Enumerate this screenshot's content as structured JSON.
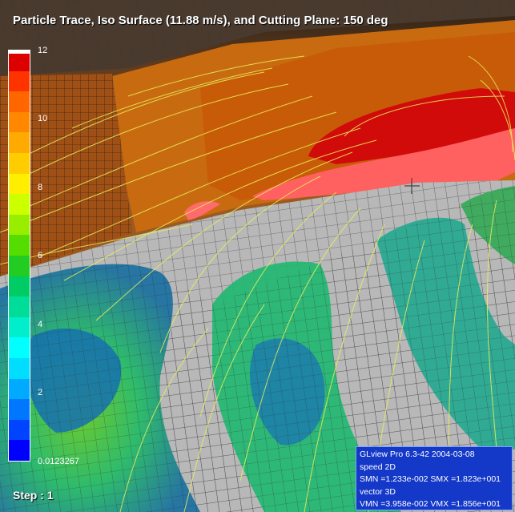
{
  "title": "Particle Trace, Iso Surface (11.88 m/s), and Cutting Plane: 150 deg",
  "step_label": "Step : 1",
  "legend": {
    "max_label": "12",
    "min_label": "0.0123267",
    "tick_labels": [
      "10",
      "8",
      "6",
      "4",
      "2"
    ],
    "colors": [
      "#dd0000",
      "#ff3300",
      "#ff6600",
      "#ff8800",
      "#ffaa00",
      "#ffcc00",
      "#ffee00",
      "#ccff00",
      "#99ee00",
      "#55dd00",
      "#22cc22",
      "#00cc66",
      "#00dd99",
      "#00eecc",
      "#00ffff",
      "#00ddff",
      "#00aaff",
      "#0077ff",
      "#0044ff",
      "#0000ff"
    ]
  },
  "info_panel": {
    "line1": "GLview Pro 6.3-42  2004-03-08",
    "line2": "speed 2D",
    "line3": "SMN =1.233e-002  SMX =1.823e+001",
    "line4": "vector 3D",
    "line5": "VMN =3.958e-002  VMX =1.856e+001"
  }
}
